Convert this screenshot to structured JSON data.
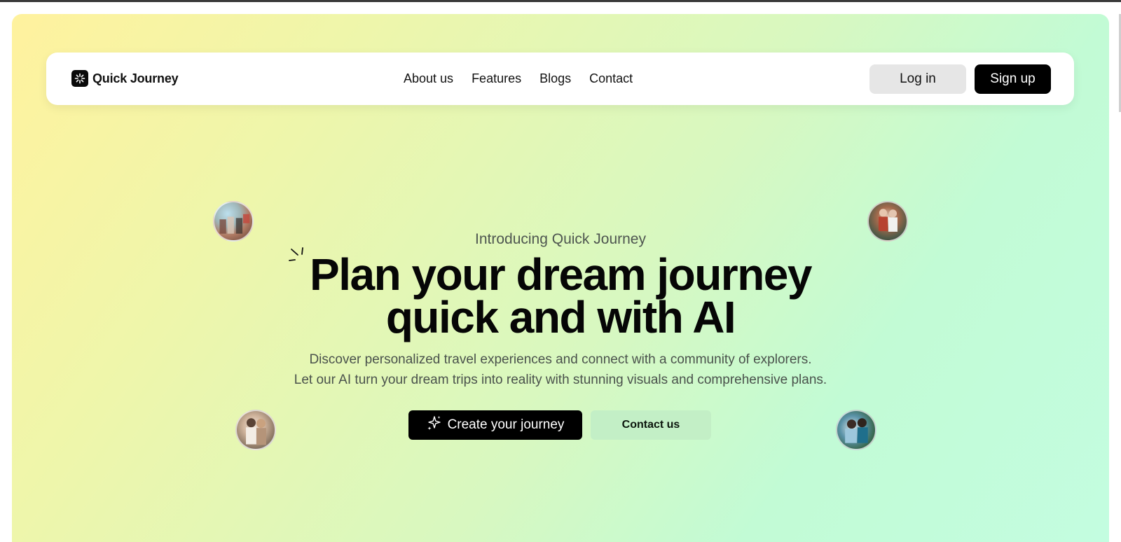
{
  "brand": {
    "name": "Quick Journey",
    "logo_icon": "sparkle-logo-icon"
  },
  "nav": {
    "links": [
      "About us",
      "Features",
      "Blogs",
      "Contact"
    ],
    "login_label": "Log in",
    "signup_label": "Sign up"
  },
  "hero": {
    "intro": "Introducing Quick Journey",
    "headline_line1": "Plan your dream journey",
    "headline_line2": "quick and with AI",
    "desc_line1": "Discover personalized travel experiences and connect with a community of explorers.",
    "desc_line2": "Let our AI turn your dream trips into reality with stunning visuals and comprehensive plans.",
    "create_label": "Create your journey",
    "contact_label": "Contact us"
  },
  "colors": {
    "accent": "#000000",
    "contact_button": "#c3efc6",
    "gradient_start": "#fff29e",
    "gradient_end": "#c3fde0"
  }
}
